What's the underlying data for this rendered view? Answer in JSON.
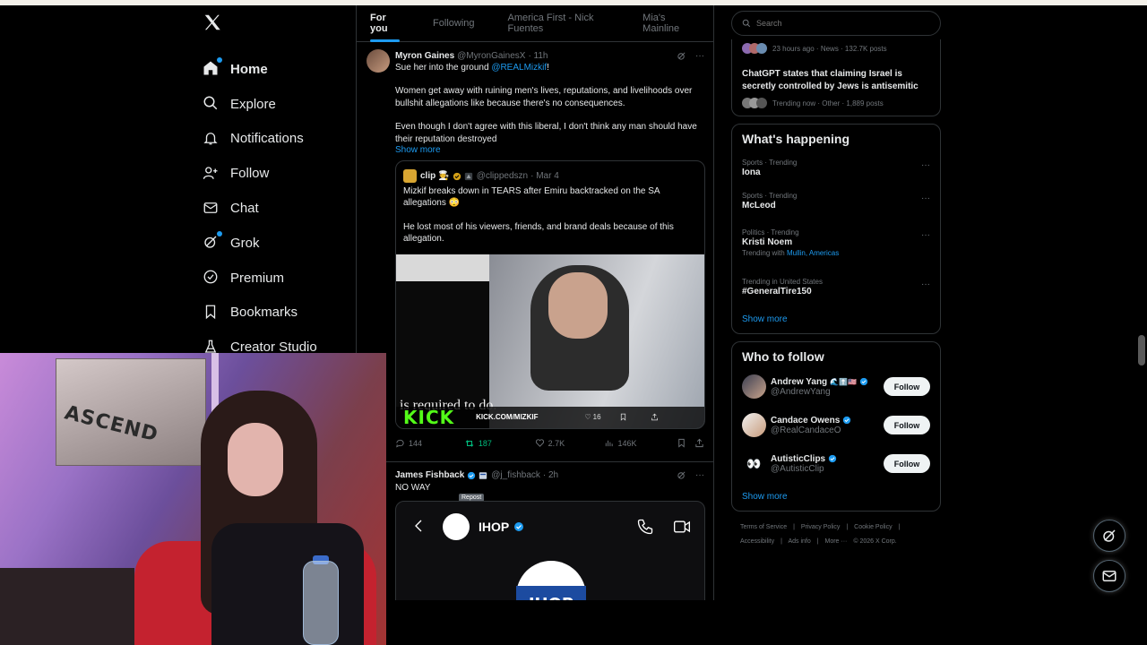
{
  "nav": {
    "items": [
      {
        "label": "Home",
        "icon": "home-icon"
      },
      {
        "label": "Explore",
        "icon": "search-icon"
      },
      {
        "label": "Notifications",
        "icon": "bell-icon"
      },
      {
        "label": "Follow",
        "icon": "person-add-icon"
      },
      {
        "label": "Chat",
        "icon": "mail-icon"
      },
      {
        "label": "Grok",
        "icon": "grok-icon"
      },
      {
        "label": "Premium",
        "icon": "x-premium-icon"
      },
      {
        "label": "Bookmarks",
        "icon": "bookmark-icon"
      },
      {
        "label": "Creator Studio",
        "icon": "flask-icon"
      }
    ]
  },
  "tabs": [
    "For you",
    "Following",
    "America First - Nick Fuentes",
    "Mia's Mainline"
  ],
  "post1": {
    "name": "Myron Gaines",
    "handle": "@MyronGainesX",
    "time": "· 11h",
    "text_pre": "Sue her into the ground ",
    "mention": "@REALMizkif",
    "text_post": "!",
    "p2": "Women get away with ruining men's lives, reputations, and livelihoods over bullshit allegations like because there's no consequences.",
    "p3": "Even though I don't agree with this liberal, I don't think any man should have their reputation destroyed",
    "show_more": "Show more",
    "quote": {
      "name": "clip",
      "handle": "@clippedszn",
      "time": "· Mar 4",
      "p1": "Mizkif breaks down in TEARS after Emiru backtracked on the SA allegations 😳",
      "p2": "He lost most of his viewers, friends, and brand deals because of this allegation.",
      "media_caption": "is required to do.",
      "kick_logo": "KICK",
      "kick_url": "KICK.COM/MIZKIF",
      "media_likes": "16"
    },
    "actions": {
      "replies": "144",
      "reposts": "187",
      "likes": "2.7K",
      "views": "146K"
    },
    "tooltip": "Repost"
  },
  "post2": {
    "name": "James Fishback",
    "handle": "@j_fishback",
    "time": "· 2h",
    "text": "NO WAY",
    "card_name": "IHOP",
    "card_logo": "IHOP"
  },
  "search": {
    "placeholder": "Search"
  },
  "trending_top": {
    "meta1": "23 hours ago · News · 132.7K posts",
    "headline": "ChatGPT states that claiming Israel is secretly controlled by Jews is antisemitic",
    "meta2": "Trending now · Other · 1,889 posts"
  },
  "whats_happening": {
    "title": "What's happening",
    "trends": [
      {
        "meta": "Sports · Trending",
        "name": "Iona",
        "extra_pre": "",
        "extra_links": ""
      },
      {
        "meta": "Sports · Trending",
        "name": "McLeod",
        "extra_pre": "",
        "extra_links": ""
      },
      {
        "meta": "Politics · Trending",
        "name": "Kristi Noem",
        "extra_pre": "Trending with ",
        "extra_links": "Mullin, Americas"
      },
      {
        "meta": "Trending in United States",
        "name": "#GeneralTire150",
        "extra_pre": "",
        "extra_links": ""
      }
    ],
    "show_more": "Show more"
  },
  "who_to_follow": {
    "title": "Who to follow",
    "accounts": [
      {
        "name": "Andrew Yang",
        "emoji": "🌊⬆️🇺🇸",
        "handle": "@AndrewYang",
        "button": "Follow"
      },
      {
        "name": "Candace Owens",
        "emoji": "",
        "handle": "@RealCandaceO",
        "button": "Follow"
      },
      {
        "name": "AutisticClips",
        "emoji": "",
        "handle": "@AutisticClip",
        "button": "Follow"
      }
    ],
    "show_more": "Show more"
  },
  "footer": {
    "links": [
      "Terms of Service",
      "|",
      "Privacy Policy",
      "|",
      "Cookie Policy",
      "|",
      "Accessibility",
      "|",
      "Ads info",
      "|",
      "More ···",
      "© 2026 X Corp."
    ]
  },
  "webcam": {
    "poster_text": "ASCEND"
  },
  "colors": {
    "accent": "#1d9bf0",
    "repost_green": "#00ba7c",
    "kick_green": "#53fc18"
  }
}
